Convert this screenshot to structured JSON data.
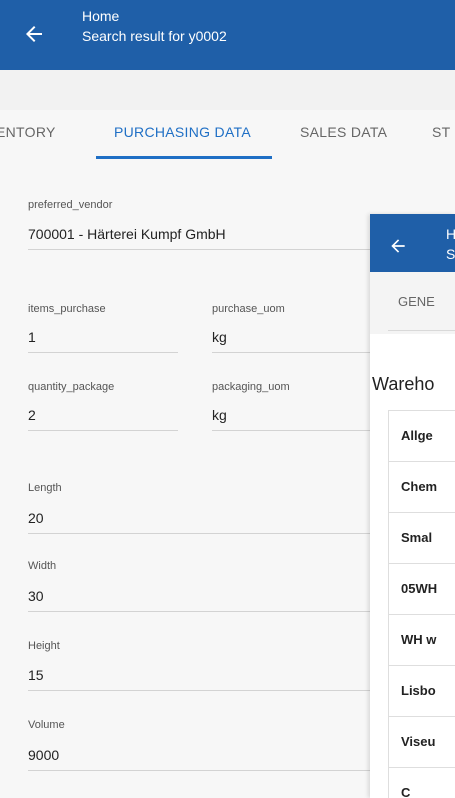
{
  "header": {
    "title": "Home",
    "subtitle": "Search result for y0002"
  },
  "tabs": [
    {
      "label": "ENTORY"
    },
    {
      "label": "PURCHASING DATA"
    },
    {
      "label": "SALES DATA"
    },
    {
      "label": "ST"
    }
  ],
  "fields": {
    "preferred_vendor": {
      "label": "preferred_vendor",
      "value": "700001 - Härterei Kumpf GmbH"
    },
    "items_purchase": {
      "label": "items_purchase",
      "value": "1"
    },
    "purchase_uom": {
      "label": "purchase_uom",
      "value": "kg"
    },
    "quantity_package": {
      "label": "quantity_package",
      "value": "2"
    },
    "packaging_uom": {
      "label": "packaging_uom",
      "value": "kg"
    },
    "length": {
      "label": "Length",
      "value": "20"
    },
    "width": {
      "label": "Width",
      "value": "30"
    },
    "height": {
      "label": "Height",
      "value": "15"
    },
    "volume": {
      "label": "Volume",
      "value": "9000"
    }
  },
  "overlay": {
    "header_t1": "H",
    "header_t2": "S",
    "tab": "GENE",
    "section_title": "Wareho",
    "items": [
      "Allge",
      "Chem",
      "Smal",
      "05WH",
      "WH w",
      "Lisbo",
      "Viseu",
      "C"
    ]
  }
}
